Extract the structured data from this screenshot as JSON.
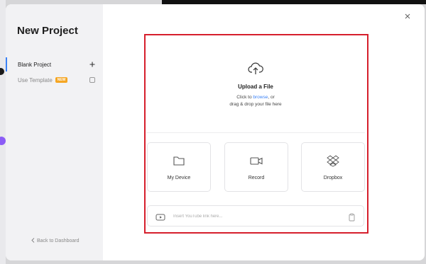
{
  "sidebar": {
    "title": "New Project",
    "items": [
      {
        "label": "Blank Project",
        "icon": "plus-icon",
        "active": true
      },
      {
        "label": "Use Template",
        "badge": "NEW",
        "icon": "template-icon",
        "active": false
      }
    ],
    "back_label": "Back to Dashboard"
  },
  "upload": {
    "title": "Upload a File",
    "hint_prefix": "Click to ",
    "hint_link": "browse",
    "hint_suffix": ", or",
    "hint_line2": "drag & drop your file here"
  },
  "sources": [
    {
      "label": "My Device",
      "icon": "folder-icon"
    },
    {
      "label": "Record",
      "icon": "video-camera-icon"
    },
    {
      "label": "Dropbox",
      "icon": "dropbox-icon"
    }
  ],
  "youtube": {
    "placeholder": "Insert YouTube link here..."
  },
  "colors": {
    "accent": "#3b82f6",
    "badge": "#f5a623",
    "highlight": "#d61f2c"
  }
}
